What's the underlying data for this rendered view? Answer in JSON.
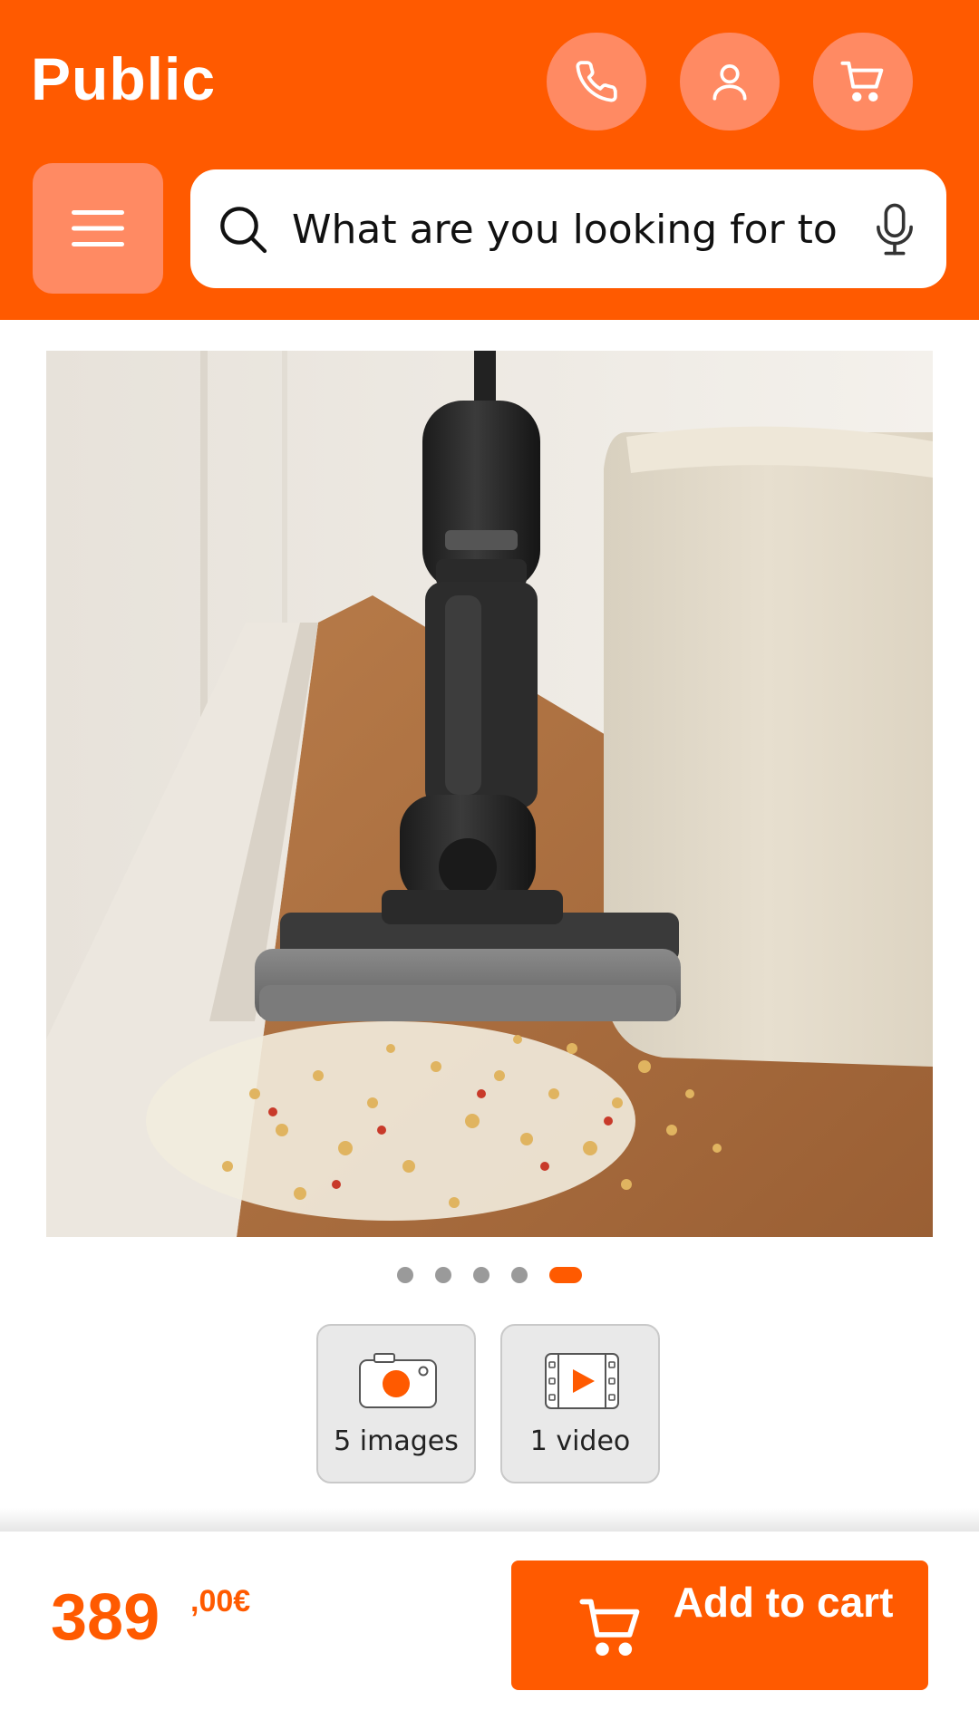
{
  "header": {
    "logo": "Public",
    "phone_icon": "phone-icon",
    "account_icon": "user-icon",
    "cart_icon": "cart-icon",
    "menu_icon": "hamburger-icon",
    "accent": "#ff5a00",
    "button_tint": "#ff8a63"
  },
  "search": {
    "placeholder": "What are you looking for to",
    "search_icon": "search-icon",
    "mic_icon": "microphone-icon"
  },
  "gallery": {
    "image_alt": "Wet and dry vacuum cleaner beside a beige sofa on wooden floor",
    "slides_total": 5,
    "active_slide": 5,
    "images_button_label": "5 images",
    "video_button_label": "1 video"
  },
  "buy_bar": {
    "price_main": "389",
    "price_decimals": ",00€",
    "add_to_cart_label": "Add to cart"
  }
}
